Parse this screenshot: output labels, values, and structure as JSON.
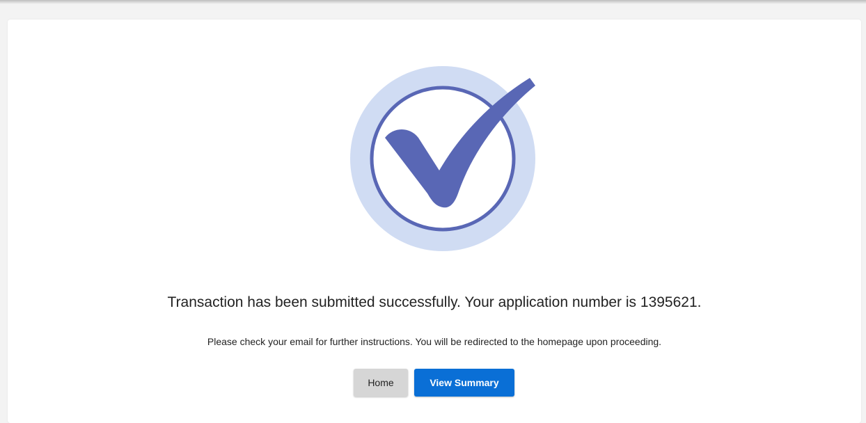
{
  "confirmation": {
    "icon": "check-circle-icon",
    "message": "Transaction has been submitted successfully. Your application number is 1395621.",
    "sub_message": "Please check your email for further instructions. You will be redirected to the homepage upon proceeding."
  },
  "actions": {
    "home_label": "Home",
    "view_summary_label": "View Summary"
  },
  "colors": {
    "icon_outer": "#d0dcf3",
    "icon_ring": "#5967b5",
    "check": "#5967b5",
    "primary_button": "#0a6fd6",
    "secondary_button": "#d6d6d6",
    "page_background": "#f3f3f3",
    "card_background": "#ffffff"
  }
}
